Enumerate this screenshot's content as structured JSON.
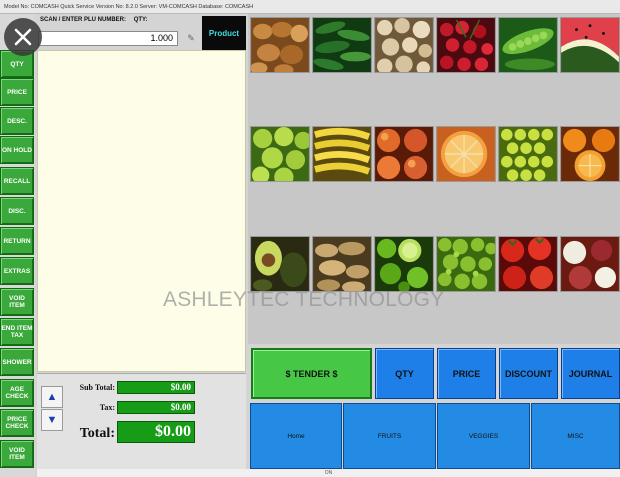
{
  "window": {
    "title": "Model No: COMCASH Quick Service  Version No: 8.2.0  Server: VM-COMCASH  Database: COMCASH"
  },
  "sidebar": {
    "items": [
      "QTY",
      "PRICE",
      "DESC.",
      "ON HOLD",
      "RECALL",
      "DISC.",
      "RETURN",
      "EXTRAS",
      "VOID ITEM",
      "END ITEM TAX",
      "SHOWER",
      "AGE CHECK",
      "PRICE CHECK",
      "VOID ITEM"
    ]
  },
  "order_entry": {
    "scan_label": "SCAN / ENTER PLU NUMBER:",
    "qty_label": "QTY:",
    "qty_value": "1.000",
    "product_button": "Product"
  },
  "totals": {
    "subtotal_label": "Sub Total:",
    "subtotal_value": "$0.00",
    "tax_label": "Tax:",
    "tax_value": "$0.00",
    "total_label": "Total:",
    "total_value": "$0.00",
    "up_arrow": "▲",
    "down_arrow": "▼"
  },
  "product_tiles": [
    "potatoes-tile",
    "cucumbers-tile",
    "mushrooms-tile",
    "cherries-tile",
    "peas-tile",
    "watermelon-tile",
    "green-apples-tile",
    "bananas-tile",
    "peaches-tile",
    "grapefruit-tile",
    "green-grapes-tile",
    "oranges-tile",
    "avocado-tile",
    "ginger-tile",
    "limes-tile",
    "lettuce-tile",
    "tomatoes-tile",
    "onions-tile"
  ],
  "actions": {
    "tender": "$ TENDER $",
    "qty": "QTY",
    "price": "PRICE",
    "discount": "DISCOUNT",
    "journal": "JOURNAL"
  },
  "categories": [
    "Home",
    "FRUITS",
    "VEGGIES",
    "MISC"
  ],
  "watermark": "ASHLEYTEC TECHNOLOGY",
  "status": "ON",
  "colors": {
    "sidebar_button": "#3aa83a",
    "action_blue": "#1f7fe8",
    "tender_green": "#46c846",
    "total_green": "#169c16",
    "product_text": "#3fdede"
  }
}
